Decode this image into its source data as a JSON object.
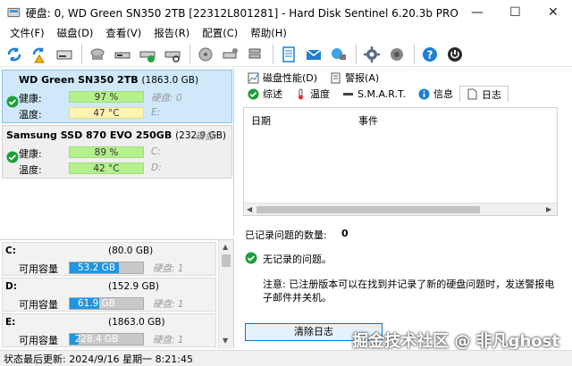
{
  "window": {
    "title": "硬盘:   0, WD Green SN350 2TB [22312L801281]  -  Hard Disk Sentinel 6.20.3b PRO",
    "min_glyph": "—",
    "max_glyph": "☐",
    "close_glyph": "✕"
  },
  "menu": [
    "文件(F)",
    "磁盘(D)",
    "查看(V)",
    "报告(R)",
    "配置(C)",
    "帮助(H)"
  ],
  "disks": [
    {
      "name": "WD Green SN350 2TB",
      "size": "(1863.0 GB)",
      "health_label": "健康:",
      "health_value": "97 %",
      "health_percent": 97,
      "temp_label": "温度:",
      "temp_value": "47 °C",
      "side_label": "硬盘: 0",
      "drive_letter": "E:"
    },
    {
      "name": "Samsung SSD 870 EVO 250GB",
      "size": "(232.9 GB)",
      "side_label": "硬盘:",
      "health_label": "健康:",
      "health_value": "89 %",
      "health_percent": 89,
      "temp_label": "温度:",
      "temp_value": "42 °C",
      "drive_c": "C:",
      "drive_d": "D:"
    }
  ],
  "volumes": [
    {
      "letter": "C:",
      "size": "(80.0 GB)",
      "label": "可用容量",
      "free": "53.2 GB",
      "free_fraction": 0.665,
      "dev": "硬盘: 1"
    },
    {
      "letter": "D:",
      "size": "(152.9 GB)",
      "label": "可用容量",
      "free": "61.9 GB",
      "free_fraction": 0.405,
      "dev": "硬盘: 1"
    },
    {
      "letter": "E:",
      "size": "(1863.0 GB)",
      "label": "可用容量",
      "free": "228.4 GB",
      "free_fraction": 0.123,
      "dev": "硬盘: 1"
    }
  ],
  "tabs_row1": [
    {
      "label": "磁盘性能(D)",
      "icon": "chart-icon"
    },
    {
      "label": "警报(A)",
      "icon": "alert-icon"
    }
  ],
  "tabs_row2": [
    {
      "label": "综述",
      "icon": "check-icon"
    },
    {
      "label": "温度",
      "icon": "thermometer-icon"
    },
    {
      "label": "S.M.A.R.T.",
      "icon": "dash-icon"
    },
    {
      "label": "信息",
      "icon": "info-icon"
    },
    {
      "label": "日志",
      "icon": "document-icon",
      "active": true
    }
  ],
  "log": {
    "col_date": "日期",
    "col_event": "事件",
    "problem_count_label": "已记录问题的数量:",
    "problem_count_value": "0",
    "no_problem_text": "无记录的问题。",
    "note": "注意: 已注册版本可以在找到并记录了新的硬盘问题时，发送警报电子邮件并关机。",
    "clear_button": "清除日志"
  },
  "status": {
    "text": "状态最后更新:    2024/9/16 星期一 8:21:45"
  },
  "watermark": "掘金技术社区 @ 非凡ghost",
  "colors": {
    "accent": "#0078d4",
    "health_green": "#b4f08c",
    "volume_blue": "#1e96e1",
    "selected_card": "#cfe9fb"
  }
}
